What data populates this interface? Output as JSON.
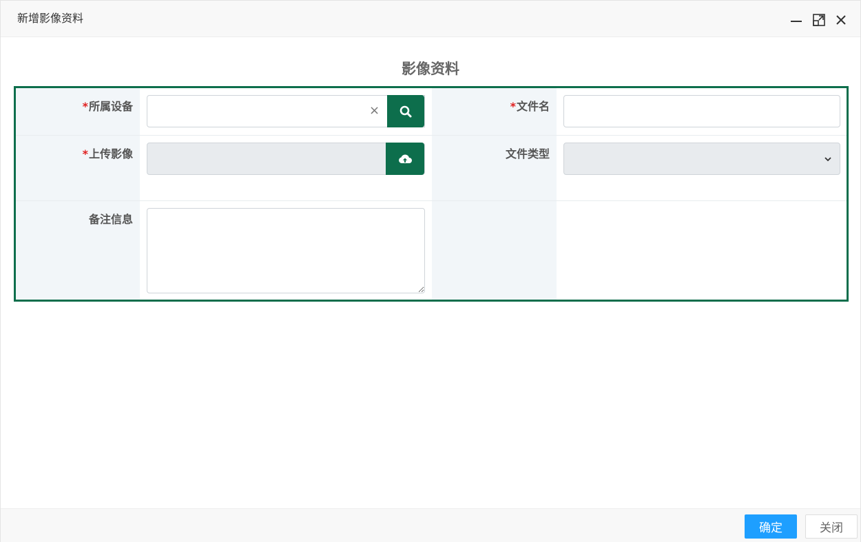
{
  "window": {
    "title": "新增影像资料"
  },
  "form": {
    "heading": "影像资料",
    "required_mark": "*",
    "fields": {
      "device": {
        "label": "所属设备",
        "required": true,
        "value": "",
        "clear_icon": "×"
      },
      "file_name": {
        "label": "文件名",
        "required": true,
        "value": ""
      },
      "upload": {
        "label": "上传影像",
        "required": true,
        "value": ""
      },
      "file_type": {
        "label": "文件类型",
        "required": false,
        "selected": ""
      },
      "remark": {
        "label": "备注信息",
        "required": false,
        "value": ""
      }
    }
  },
  "footer": {
    "confirm_label": "确定",
    "close_label": "关闭"
  },
  "colors": {
    "accent_green": "#0d6e4c",
    "primary_blue": "#1e9fff",
    "required_red": "#e02020"
  },
  "icons": {
    "minimize": "minimize-icon",
    "maximize": "maximize-icon",
    "close": "close-icon",
    "search": "search-icon",
    "upload": "cloud-upload-icon",
    "dropdown": "chevron-down-icon"
  }
}
